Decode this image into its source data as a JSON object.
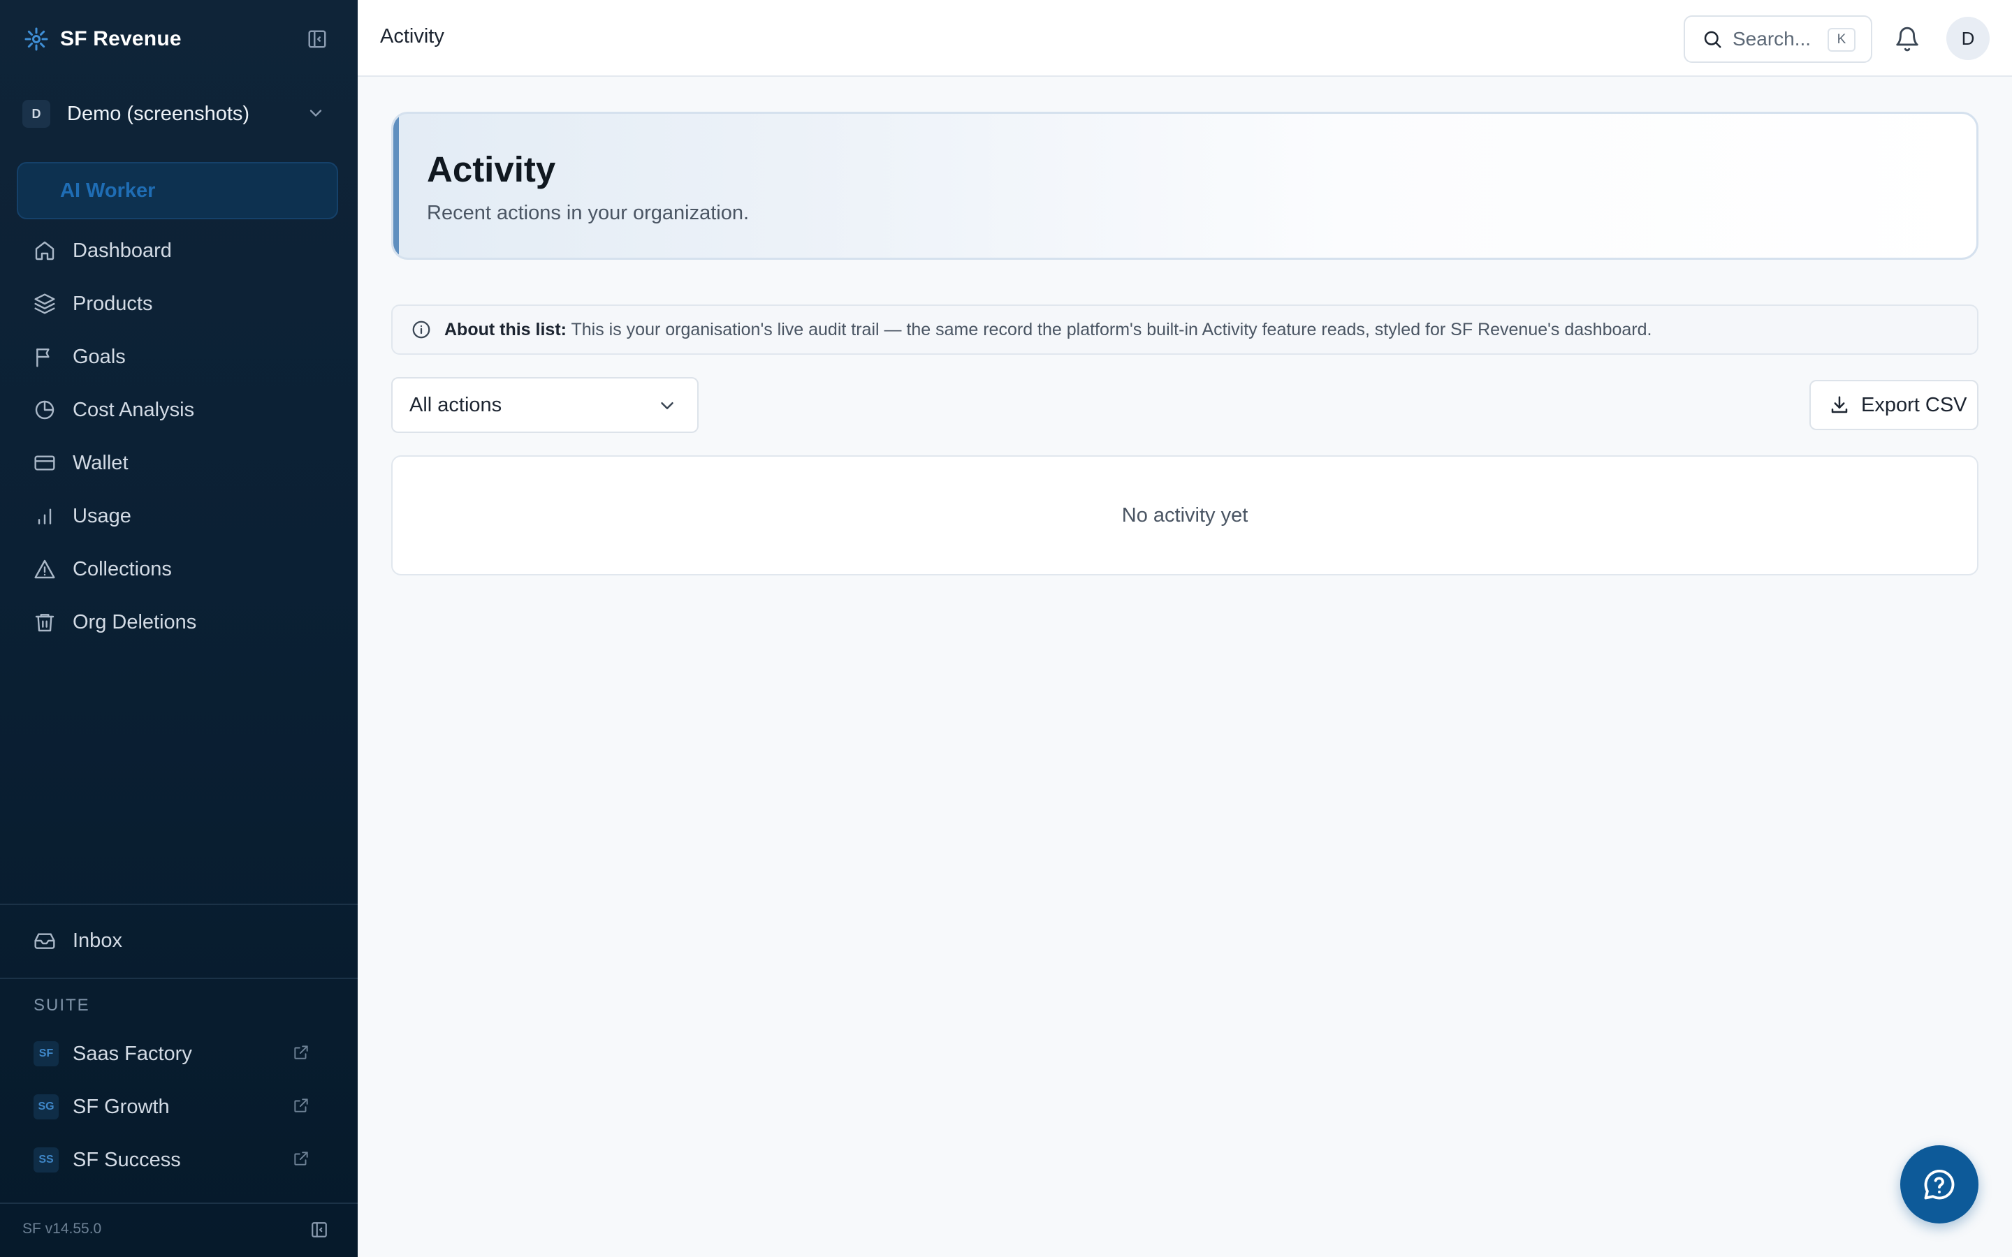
{
  "app": {
    "brand_name": "SF Revenue",
    "version": "SF v14.55.0"
  },
  "org": {
    "avatar_letter": "D",
    "name": "Demo (screenshots)"
  },
  "sidebar": {
    "ai_worker_label": "AI Worker",
    "items": [
      {
        "label": "Dashboard",
        "icon": "home-icon"
      },
      {
        "label": "Products",
        "icon": "layers-icon"
      },
      {
        "label": "Goals",
        "icon": "flag-icon"
      },
      {
        "label": "Cost Analysis",
        "icon": "pie-chart-icon"
      },
      {
        "label": "Wallet",
        "icon": "credit-card-icon"
      },
      {
        "label": "Usage",
        "icon": "bar-chart-icon"
      },
      {
        "label": "Collections",
        "icon": "alert-triangle-icon"
      },
      {
        "label": "Org Deletions",
        "icon": "trash-icon"
      }
    ],
    "inbox_label": "Inbox",
    "suite_label": "SUITE",
    "suite_items": [
      {
        "badge": "SF",
        "label": "Saas Factory"
      },
      {
        "badge": "SG",
        "label": "SF Growth"
      },
      {
        "badge": "SS",
        "label": "SF Success"
      }
    ]
  },
  "topbar": {
    "page_title": "Activity",
    "search_placeholder": "Search...",
    "search_shortcut": "K",
    "user_avatar_letter": "D"
  },
  "hero": {
    "title": "Activity",
    "subtitle": "Recent actions in your organization."
  },
  "info": {
    "label": "About this list:",
    "text": "This is your organisation's live audit trail — the same record the platform's built-in Activity feature reads, styled for SF Revenue's dashboard."
  },
  "filter": {
    "selected": "All actions"
  },
  "export": {
    "label": "Export CSV"
  },
  "activity": {
    "empty_text": "No activity yet"
  },
  "colors": {
    "sidebar_bg": "#0b2034",
    "accent": "#0d5a99",
    "ai_worker_text": "#1f6db4"
  }
}
